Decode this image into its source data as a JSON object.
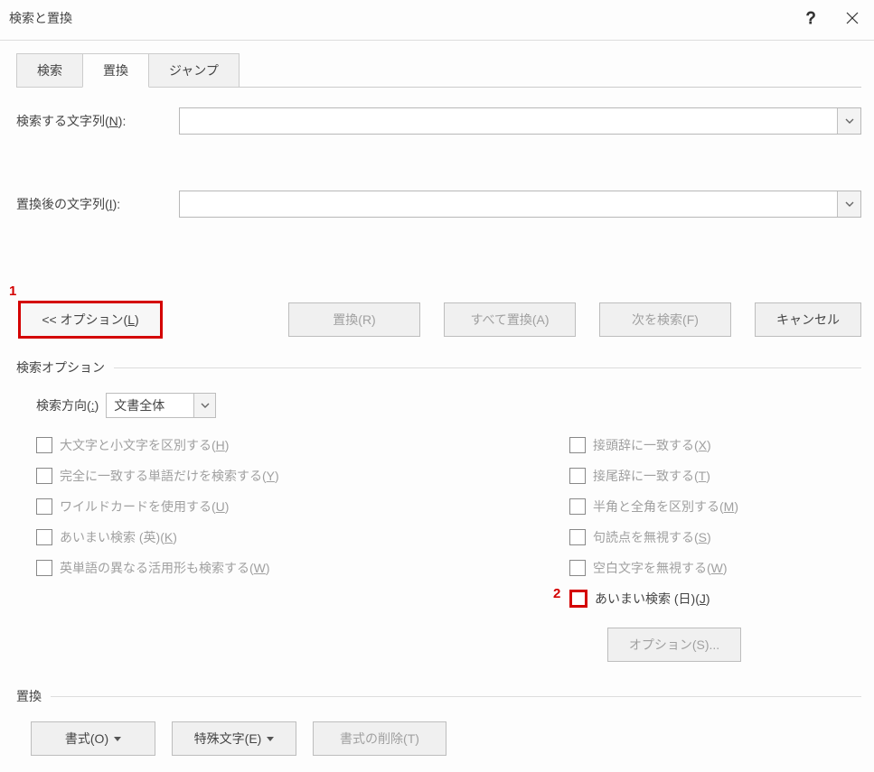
{
  "title": "検索と置換",
  "tabs": {
    "search": "検索",
    "replace": "置換",
    "jump": "ジャンプ"
  },
  "fields": {
    "findLabel": "検索する文字列(",
    "findKey": "N",
    "findLabelEnd": "):",
    "replaceLabel": "置換後の文字列(",
    "replaceKey": "I",
    "replaceLabelEnd": "):",
    "findValue": "",
    "replaceValue": ""
  },
  "buttons": {
    "options": "<< オプション(",
    "optionsKey": "L",
    "optionsEnd": ")",
    "replace": "置換(R)",
    "replaceAll": "すべて置換(A)",
    "findNext": "次を検索(F)",
    "cancel": "キャンセル"
  },
  "searchOptionsHeader": "検索オプション",
  "direction": {
    "label": "検索方向(",
    "key": ":",
    "labelEnd": ")",
    "value": "文書全体"
  },
  "checks": {
    "matchCase": {
      "text": "大文字と小文字を区別する(",
      "key": "H",
      "end": ")"
    },
    "wholeWord": {
      "text": "完全に一致する単語だけを検索する(",
      "key": "Y",
      "end": ")"
    },
    "wildcard": {
      "text": "ワイルドカードを使用する(",
      "key": "U",
      "end": ")"
    },
    "soundsEn": {
      "text": "あいまい検索 (英)(",
      "key": "K",
      "end": ")"
    },
    "wordForms": {
      "text": "英単語の異なる活用形も検索する(",
      "key": "W",
      "end": ")"
    },
    "prefix": {
      "text": "接頭辞に一致する(",
      "key": "X",
      "end": ")"
    },
    "suffix": {
      "text": "接尾辞に一致する(",
      "key": "T",
      "end": ")"
    },
    "halfFull": {
      "text": "半角と全角を区別する(",
      "key": "M",
      "end": ")"
    },
    "ignorePunct": {
      "text": "句読点を無視する(",
      "key": "S",
      "end": ")"
    },
    "ignoreSpace": {
      "text": "空白文字を無視する(",
      "key": "W",
      "end": ")"
    },
    "soundsJa": {
      "text": "あいまい検索 (日)(",
      "key": "J",
      "end": ")"
    }
  },
  "optBtn": "オプション(S)...",
  "replaceHeader": "置換",
  "formatButtons": {
    "format": {
      "text": "書式(",
      "key": "O",
      "end": ")"
    },
    "special": {
      "text": "特殊文字(",
      "key": "E",
      "end": ")"
    },
    "noFormat": "書式の削除(T)"
  },
  "annotations": {
    "one": "1",
    "two": "2"
  }
}
